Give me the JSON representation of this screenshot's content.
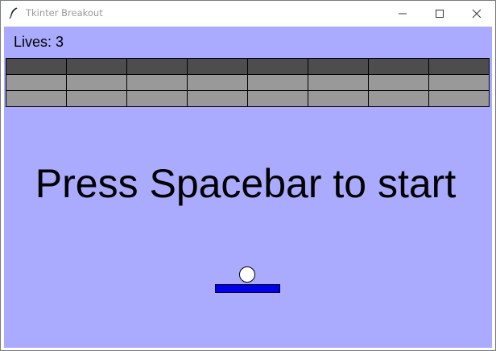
{
  "window": {
    "title": "Tkinter Breakout"
  },
  "hud": {
    "lives_text": "Lives: 3",
    "lives": 3
  },
  "message": {
    "text": "Press Spacebar to start"
  },
  "bricks": {
    "columns": 8,
    "rows": [
      {
        "color": "#4d4d4d"
      },
      {
        "color": "#999999"
      },
      {
        "color": "#999999"
      }
    ]
  },
  "colors": {
    "background": "#aaaaff",
    "paddle": "#0000ee",
    "ball": "#ffffff"
  },
  "icons": {
    "app": "feather-icon",
    "minimize": "minimize-icon",
    "maximize": "maximize-icon",
    "close": "close-icon"
  }
}
